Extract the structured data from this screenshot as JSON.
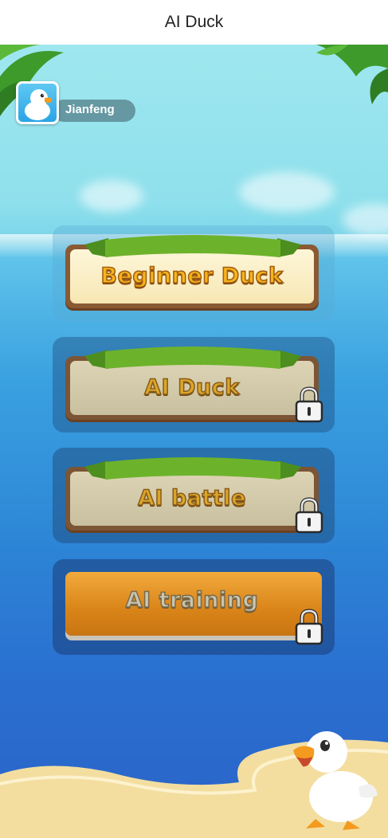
{
  "window": {
    "title": "AI Duck"
  },
  "user": {
    "name": "Jianfeng",
    "avatar": "duck-avatar"
  },
  "modes": [
    {
      "label": "Beginner Duck",
      "locked": false,
      "style": "wooden-plank-active"
    },
    {
      "label": "AI Duck",
      "locked": true,
      "style": "wooden-plank-locked"
    },
    {
      "label": "AI battle",
      "locked": true,
      "style": "wooden-plank-locked"
    },
    {
      "label": "AI training",
      "locked": true,
      "style": "orange-button"
    }
  ],
  "icons": {
    "lock": "lock-icon",
    "banner": "ribbon-banner-icon",
    "mascot": "duck-mascot"
  },
  "colors": {
    "sky": "#9fe7ef",
    "sea": "#2a6fd0",
    "label_gold": "#f5b51c",
    "orange": "#d98418",
    "banner_green": "#6db22b"
  }
}
